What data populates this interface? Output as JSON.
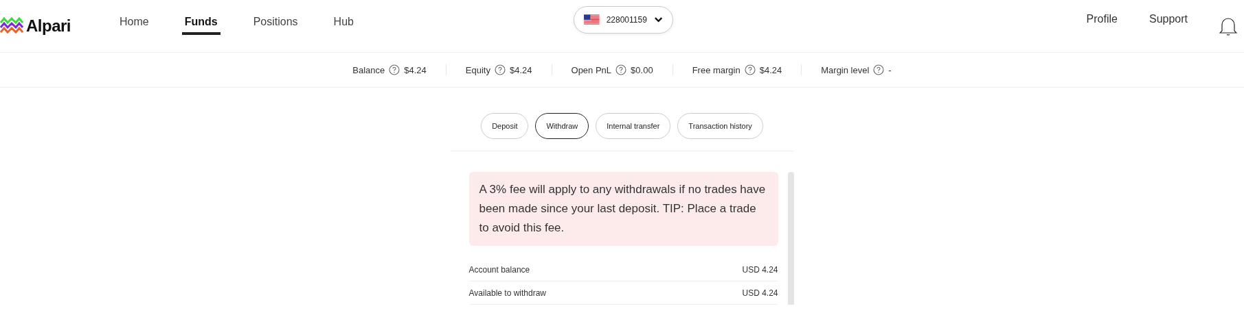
{
  "header": {
    "logo": "Alpari",
    "nav": [
      {
        "label": "Home",
        "selected": false
      },
      {
        "label": "Funds",
        "selected": true
      },
      {
        "label": "Positions",
        "selected": false
      },
      {
        "label": "Hub",
        "selected": false
      }
    ],
    "account": "228001159",
    "links": [
      "Profile",
      "Support"
    ]
  },
  "stats": [
    {
      "label": "Balance",
      "value": "$4.24"
    },
    {
      "label": "Equity",
      "value": "$4.24"
    },
    {
      "label": "Open PnL",
      "value": "$0.00"
    },
    {
      "label": "Free margin",
      "value": "$4.24"
    },
    {
      "label": "Margin level",
      "value": "-"
    }
  ],
  "tabs": [
    {
      "label": "Deposit",
      "selected": false
    },
    {
      "label": "Withdraw",
      "selected": true
    },
    {
      "label": "Internal transfer",
      "selected": false
    },
    {
      "label": "Transaction history",
      "selected": false
    }
  ],
  "notice": "A 3% fee will apply to any withdrawals if no trades have been made since your last deposit. TIP: Place a trade to avoid this fee.",
  "rows": [
    {
      "label": "Account balance",
      "value": "USD 4.24"
    },
    {
      "label": "Available to withdraw",
      "value": "USD 4.24"
    }
  ]
}
